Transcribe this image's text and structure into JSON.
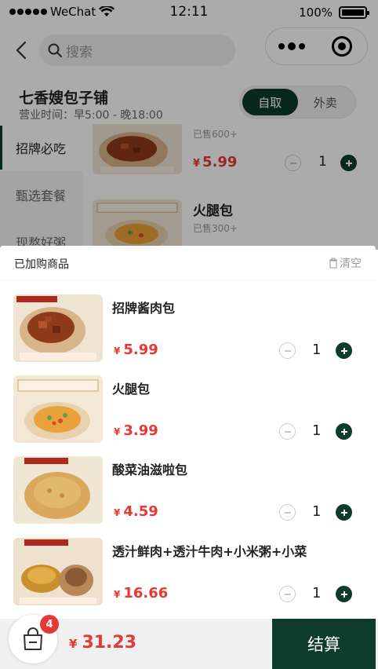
{
  "status_bar": {
    "carrier": "WeChat",
    "time": "12:11",
    "battery": "100%"
  },
  "nav": {
    "search_placeholder": "搜索"
  },
  "shop": {
    "name": "七香嫂包子铺",
    "hours": "营业时间：早5:00 - 晚18:00",
    "modes": [
      {
        "label": "自取",
        "active": true
      },
      {
        "label": "外卖",
        "active": false
      }
    ]
  },
  "categories": [
    {
      "label": "招牌必吃",
      "active": true
    },
    {
      "label": "甄选套餐",
      "active": false
    },
    {
      "label": "现熬好粥",
      "active": false
    }
  ],
  "menu_items": [
    {
      "name": "招牌酱肉包",
      "sold": "已售600+",
      "currency": "¥",
      "price": "5.99",
      "qty": "1",
      "thumb": "meat"
    },
    {
      "name": "火腿包",
      "sold": "已售300+",
      "currency": "¥",
      "price": "",
      "qty": "",
      "thumb": "ham"
    }
  ],
  "cart": {
    "title": "已加购商品",
    "clear_label": "清空",
    "items": [
      {
        "name": "招牌酱肉包",
        "currency": "¥",
        "price": "5.99",
        "qty": "1",
        "thumb": "meat"
      },
      {
        "name": "火腿包",
        "currency": "¥",
        "price": "3.99",
        "qty": "1",
        "thumb": "ham"
      },
      {
        "name": "酸菜油滋啦包",
        "currency": "¥",
        "price": "4.59",
        "qty": "1",
        "thumb": "sauerkraut"
      },
      {
        "name": "透汁鲜肉+透汁牛肉+小米粥+小菜",
        "currency": "¥",
        "price": "16.66",
        "qty": "1",
        "thumb": "combo"
      }
    ]
  },
  "bottom_bar": {
    "badge_count": "4",
    "currency": "¥",
    "total": "31.23",
    "checkout_label": "结算"
  },
  "colors": {
    "brand": "#0d3b2c",
    "price": "#e53935",
    "badge": "#e53935"
  }
}
